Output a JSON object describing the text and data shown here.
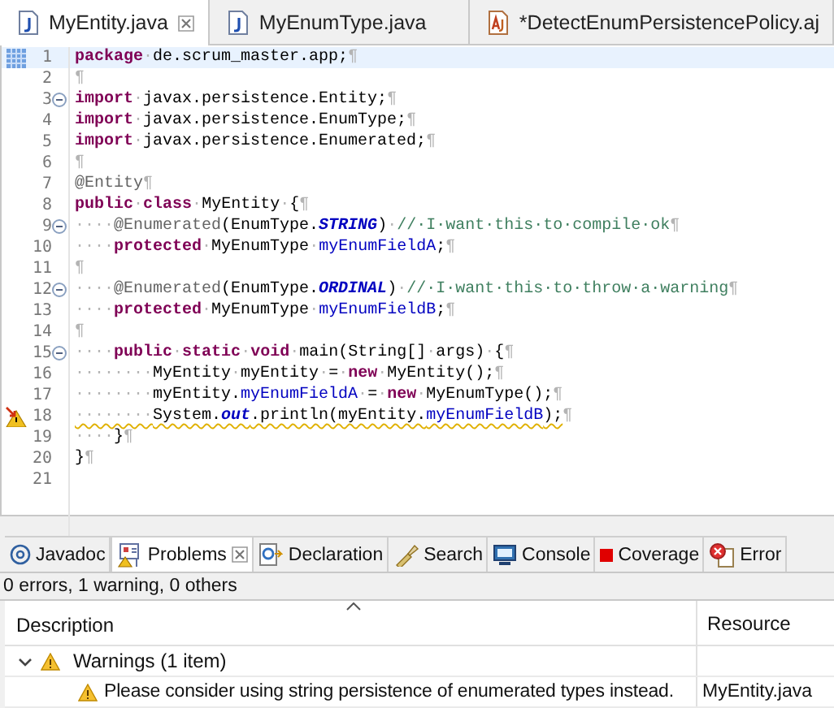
{
  "editor_tabs": [
    {
      "label": "MyEntity.java",
      "kind": "java",
      "selected": true,
      "closable": true
    },
    {
      "label": "MyEnumType.java",
      "kind": "java",
      "selected": false,
      "closable": false
    },
    {
      "label": "*DetectEnumPersistencePolicy.aj",
      "kind": "aspect",
      "selected": false,
      "closable": false
    }
  ],
  "code_lines": [
    {
      "number": "1",
      "current": true,
      "tokens": [
        {
          "kind": "kw",
          "t": "package"
        },
        {
          "kind": "ws",
          "t": "·"
        },
        {
          "kind": "plain",
          "t": "de.scrum_master.app;"
        },
        {
          "kind": "ws",
          "t": "¶"
        }
      ]
    },
    {
      "number": "2",
      "tokens": [
        {
          "kind": "ws",
          "t": "¶"
        }
      ]
    },
    {
      "number": "3",
      "foldable": true,
      "tokens": [
        {
          "kind": "kw",
          "t": "import"
        },
        {
          "kind": "ws",
          "t": "·"
        },
        {
          "kind": "plain",
          "t": "javax.persistence.Entity;"
        },
        {
          "kind": "ws",
          "t": "¶"
        }
      ]
    },
    {
      "number": "4",
      "tokens": [
        {
          "kind": "kw",
          "t": "import"
        },
        {
          "kind": "ws",
          "t": "·"
        },
        {
          "kind": "plain",
          "t": "javax.persistence.EnumType;"
        },
        {
          "kind": "ws",
          "t": "¶"
        }
      ]
    },
    {
      "number": "5",
      "tokens": [
        {
          "kind": "kw",
          "t": "import"
        },
        {
          "kind": "ws",
          "t": "·"
        },
        {
          "kind": "plain",
          "t": "javax.persistence.Enumerated;"
        },
        {
          "kind": "ws",
          "t": "¶"
        }
      ]
    },
    {
      "number": "6",
      "tokens": [
        {
          "kind": "ws",
          "t": "¶"
        }
      ]
    },
    {
      "number": "7",
      "tokens": [
        {
          "kind": "ann",
          "t": "@Entity"
        },
        {
          "kind": "ws",
          "t": "¶"
        }
      ]
    },
    {
      "number": "8",
      "tokens": [
        {
          "kind": "kw",
          "t": "public"
        },
        {
          "kind": "ws",
          "t": "·"
        },
        {
          "kind": "kw",
          "t": "class"
        },
        {
          "kind": "ws",
          "t": "·"
        },
        {
          "kind": "plain",
          "t": "MyEntity"
        },
        {
          "kind": "ws",
          "t": "·"
        },
        {
          "kind": "plain",
          "t": "{"
        },
        {
          "kind": "ws",
          "t": "¶"
        }
      ]
    },
    {
      "number": "9",
      "foldable": true,
      "tokens": [
        {
          "kind": "ws",
          "t": "····"
        },
        {
          "kind": "ann",
          "t": "@Enumerated"
        },
        {
          "kind": "plain",
          "t": "(EnumType."
        },
        {
          "kind": "static",
          "t": "STRING"
        },
        {
          "kind": "plain",
          "t": ")"
        },
        {
          "kind": "ws",
          "t": "·"
        },
        {
          "kind": "comment",
          "t": "//·I·want·this·to·compile·ok"
        },
        {
          "kind": "ws",
          "t": "¶"
        }
      ]
    },
    {
      "number": "10",
      "tokens": [
        {
          "kind": "ws",
          "t": "····"
        },
        {
          "kind": "kw",
          "t": "protected"
        },
        {
          "kind": "ws",
          "t": "·"
        },
        {
          "kind": "plain",
          "t": "MyEnumType"
        },
        {
          "kind": "ws",
          "t": "·"
        },
        {
          "kind": "field",
          "t": "myEnumFieldA"
        },
        {
          "kind": "plain",
          "t": ";"
        },
        {
          "kind": "ws",
          "t": "¶"
        }
      ]
    },
    {
      "number": "11",
      "tokens": [
        {
          "kind": "ws",
          "t": "¶"
        }
      ]
    },
    {
      "number": "12",
      "foldable": true,
      "tokens": [
        {
          "kind": "ws",
          "t": "····"
        },
        {
          "kind": "ann",
          "t": "@Enumerated"
        },
        {
          "kind": "plain",
          "t": "(EnumType."
        },
        {
          "kind": "static",
          "t": "ORDINAL"
        },
        {
          "kind": "plain",
          "t": ")"
        },
        {
          "kind": "ws",
          "t": "·"
        },
        {
          "kind": "comment",
          "t": "//·I·want·this·to·throw·a·warning"
        },
        {
          "kind": "ws",
          "t": "¶"
        }
      ]
    },
    {
      "number": "13",
      "tokens": [
        {
          "kind": "ws",
          "t": "····"
        },
        {
          "kind": "kw",
          "t": "protected"
        },
        {
          "kind": "ws",
          "t": "·"
        },
        {
          "kind": "plain",
          "t": "MyEnumType"
        },
        {
          "kind": "ws",
          "t": "·"
        },
        {
          "kind": "field",
          "t": "myEnumFieldB"
        },
        {
          "kind": "plain",
          "t": ";"
        },
        {
          "kind": "ws",
          "t": "¶"
        }
      ]
    },
    {
      "number": "14",
      "tokens": [
        {
          "kind": "ws",
          "t": "¶"
        }
      ]
    },
    {
      "number": "15",
      "foldable": true,
      "tokens": [
        {
          "kind": "ws",
          "t": "····"
        },
        {
          "kind": "kw",
          "t": "public"
        },
        {
          "kind": "ws",
          "t": "·"
        },
        {
          "kind": "kw",
          "t": "static"
        },
        {
          "kind": "ws",
          "t": "·"
        },
        {
          "kind": "kw",
          "t": "void"
        },
        {
          "kind": "ws",
          "t": "·"
        },
        {
          "kind": "plain",
          "t": "main(String[]"
        },
        {
          "kind": "ws",
          "t": "·"
        },
        {
          "kind": "plain",
          "t": "args)"
        },
        {
          "kind": "ws",
          "t": "·"
        },
        {
          "kind": "plain",
          "t": "{"
        },
        {
          "kind": "ws",
          "t": "¶"
        }
      ]
    },
    {
      "number": "16",
      "tokens": [
        {
          "kind": "ws",
          "t": "········"
        },
        {
          "kind": "plain",
          "t": "MyEntity"
        },
        {
          "kind": "ws",
          "t": "·"
        },
        {
          "kind": "plain",
          "t": "myEntity"
        },
        {
          "kind": "ws",
          "t": "·"
        },
        {
          "kind": "plain",
          "t": "="
        },
        {
          "kind": "ws",
          "t": "·"
        },
        {
          "kind": "kw",
          "t": "new"
        },
        {
          "kind": "ws",
          "t": "·"
        },
        {
          "kind": "plain",
          "t": "MyEntity();"
        },
        {
          "kind": "ws",
          "t": "¶"
        }
      ]
    },
    {
      "number": "17",
      "tokens": [
        {
          "kind": "ws",
          "t": "········"
        },
        {
          "kind": "plain",
          "t": "myEntity."
        },
        {
          "kind": "field",
          "t": "myEnumFieldA"
        },
        {
          "kind": "ws",
          "t": "·"
        },
        {
          "kind": "plain",
          "t": "="
        },
        {
          "kind": "ws",
          "t": "·"
        },
        {
          "kind": "kw",
          "t": "new"
        },
        {
          "kind": "ws",
          "t": "·"
        },
        {
          "kind": "plain",
          "t": "MyEnumType();"
        },
        {
          "kind": "ws",
          "t": "¶"
        }
      ]
    },
    {
      "number": "18",
      "warning": true,
      "tokens": [
        {
          "kind": "ws",
          "t": "········",
          "u": true
        },
        {
          "kind": "plain",
          "t": "System.",
          "u": true
        },
        {
          "kind": "static",
          "t": "out",
          "u": true
        },
        {
          "kind": "plain",
          "t": ".println(myEntity.",
          "u": true
        },
        {
          "kind": "field",
          "t": "myEnumFieldB",
          "u": true
        },
        {
          "kind": "plain",
          "t": ");",
          "u": true
        },
        {
          "kind": "ws",
          "t": "¶"
        }
      ]
    },
    {
      "number": "19",
      "tokens": [
        {
          "kind": "ws",
          "t": "····"
        },
        {
          "kind": "plain",
          "t": "}"
        },
        {
          "kind": "ws",
          "t": "¶"
        }
      ]
    },
    {
      "number": "20",
      "tokens": [
        {
          "kind": "plain",
          "t": "}"
        },
        {
          "kind": "ws",
          "t": "¶"
        }
      ]
    },
    {
      "number": "21"
    }
  ],
  "panel_tabs": [
    {
      "label": "Javadoc",
      "kind": "at",
      "selected": false
    },
    {
      "label": "Problems",
      "kind": "problems",
      "selected": true
    },
    {
      "label": "Declaration",
      "kind": "declaration",
      "selected": false
    },
    {
      "label": "Search",
      "kind": "torch",
      "selected": false
    },
    {
      "label": "Console",
      "kind": "monitor",
      "selected": false
    },
    {
      "label": "Coverage",
      "kind": "square",
      "selected": false
    },
    {
      "label": "Error",
      "kind": "error",
      "selected": false
    }
  ],
  "problems": {
    "summary": "0 errors, 1 warning, 0 others",
    "columns": [
      {
        "label": "Description",
        "sorted": true
      },
      {
        "label": "Resource",
        "sorted": false
      }
    ],
    "groups": [
      {
        "label": "Warnings (1 item)",
        "expanded": true,
        "children": [
          {
            "description": "Please consider using string persistence of enumerated types instead.",
            "resource": "MyEntity.java"
          }
        ]
      }
    ]
  }
}
